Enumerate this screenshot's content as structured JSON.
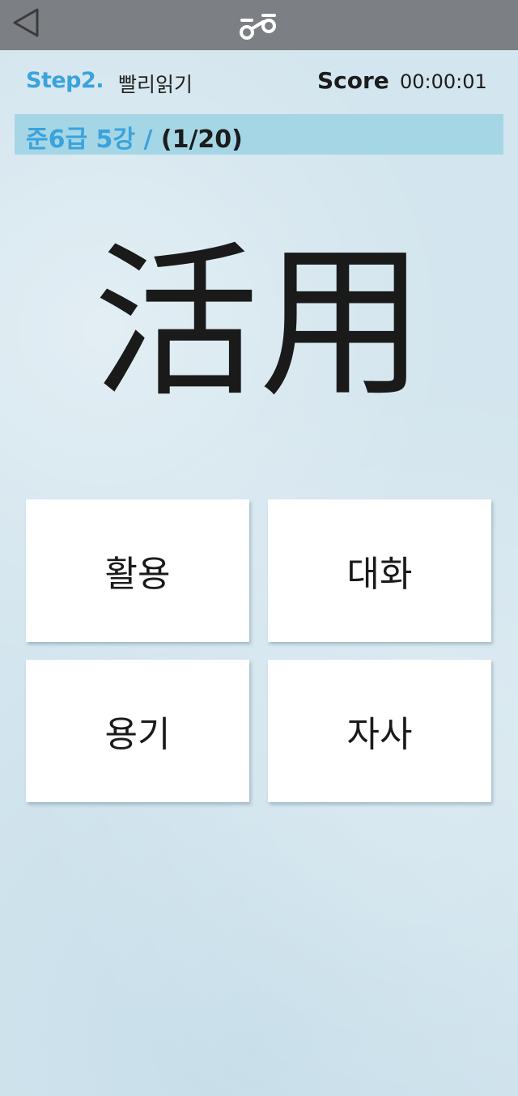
{
  "header": {
    "logo_icon": "app-logo-icon",
    "back_icon": "back-triangle-icon"
  },
  "step": {
    "label": "Step2.",
    "mode": "빨리읽기"
  },
  "score": {
    "label": "Score",
    "timer": "00:00:01"
  },
  "level": {
    "name": "준6급 5강",
    "separator": "/",
    "progress": "(1/20)"
  },
  "question": {
    "hanja": "活用"
  },
  "answers": [
    {
      "label": "활용"
    },
    {
      "label": "대화"
    },
    {
      "label": "용기"
    },
    {
      "label": "자사"
    }
  ],
  "colors": {
    "topbar": "#7c7f83",
    "accent": "#3aa3dc",
    "level_bar": "#a5d6e6",
    "background": "#d3e5ee"
  }
}
